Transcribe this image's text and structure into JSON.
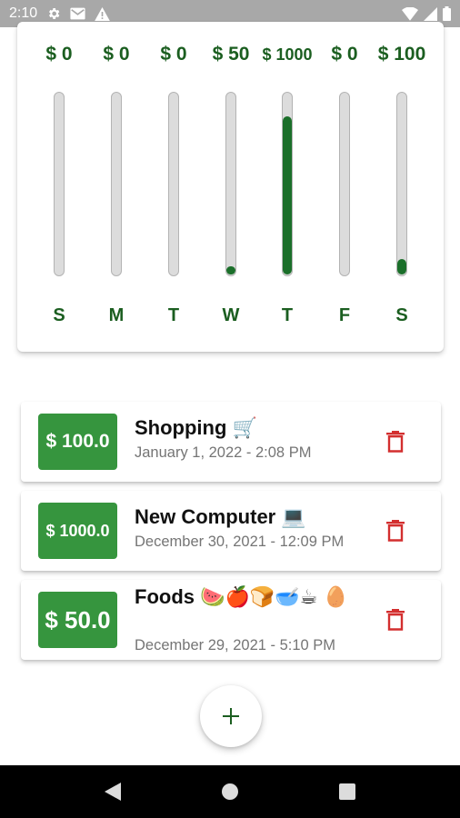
{
  "status_bar": {
    "time": "2:10",
    "icons": [
      "settings-icon",
      "gmail-icon",
      "warning-icon",
      "wifi-icon",
      "cellular-signal-icon",
      "battery-icon"
    ]
  },
  "chart": {
    "bars": [
      {
        "day": "S",
        "amount_label": "$ 0",
        "fill_fraction": 0
      },
      {
        "day": "M",
        "amount_label": "$ 0",
        "fill_fraction": 0
      },
      {
        "day": "T",
        "amount_label": "$ 0",
        "fill_fraction": 0
      },
      {
        "day": "W",
        "amount_label": "$ 50",
        "fill_fraction": 0.043
      },
      {
        "day": "T",
        "amount_label": "$ 1000",
        "fill_fraction": 0.87
      },
      {
        "day": "F",
        "amount_label": "$ 0",
        "fill_fraction": 0
      },
      {
        "day": "S",
        "amount_label": "$ 100",
        "fill_fraction": 0.087
      }
    ]
  },
  "transactions": [
    {
      "amount": "$ 100.0",
      "title": "Shopping 🛒",
      "date": "January 1, 2022 - 2:08 PM"
    },
    {
      "amount": "$ 1000.0",
      "title": "New Computer 💻",
      "date": "December 30, 2021 - 12:09 PM"
    },
    {
      "amount": "$ 50.0",
      "title": "Foods 🍉🍎🍞🥣☕ 🥚",
      "date": "December 29, 2021 - 5:10 PM"
    }
  ],
  "fab": {
    "icon": "plus-icon"
  },
  "nav_bar": {
    "icons": [
      "back-icon",
      "home-icon",
      "recents-icon"
    ]
  },
  "colors": {
    "primary_dark": "#1b5e20",
    "bar_fill": "#1b6f2a",
    "amount_badge": "#36953e",
    "delete": "#d32f2f",
    "status_bar": "#a8a8a8"
  }
}
